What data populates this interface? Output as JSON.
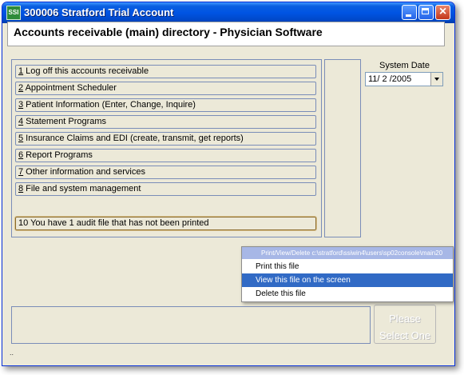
{
  "window": {
    "title": "300006 Stratford Trial Account",
    "icon_text": "SSI"
  },
  "header": {
    "title": "Accounts receivable (main) directory - Physician Software"
  },
  "menu": {
    "items": [
      {
        "num": "1",
        "label": " Log off this accounts receivable"
      },
      {
        "num": "2",
        "label": " Appointment Scheduler"
      },
      {
        "num": "3",
        "label": " Patient Information (Enter, Change, Inquire)"
      },
      {
        "num": "4",
        "label": " Statement Programs"
      },
      {
        "num": "5",
        "label": " Insurance Claims and EDI (create, transmit, get reports)"
      },
      {
        "num": "6",
        "label": " Report Programs"
      },
      {
        "num": "7",
        "label": " Other information and services"
      },
      {
        "num": "8",
        "label": " File and system management"
      }
    ],
    "audit_message": "10 You have 1 audit file that has not been printed"
  },
  "system_date": {
    "label": "System Date",
    "value": "11/ 2 /2005"
  },
  "context_menu": {
    "header": "Print/View/Delete c:\\stratford\\ssiwin4\\users\\sp02console\\main20",
    "items": [
      "Print this file",
      "View this file on the screen",
      "Delete this file"
    ],
    "selected_index": 1
  },
  "please_button": {
    "line1": "Please",
    "line2": "Select One"
  },
  "status": {
    "dots": ".."
  },
  "colors": {
    "titlebar": "#0054e3",
    "selection": "#316ac5",
    "window_bg": "#ece9d8"
  }
}
